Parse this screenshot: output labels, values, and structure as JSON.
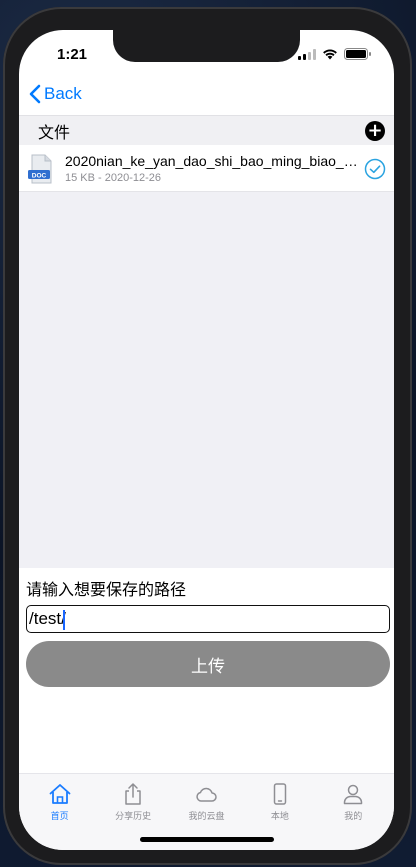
{
  "status_bar": {
    "time": "1:21"
  },
  "nav": {
    "back_label": "Back"
  },
  "section": {
    "title": "文件"
  },
  "file": {
    "icon_label": "DOC",
    "name": "2020nian_ke_yan_dao_shi_bao_ming_biao_.d...",
    "meta": "15 KB - 2020-12-26"
  },
  "path": {
    "label": "请输入想要保存的路径",
    "value": "/test/"
  },
  "upload": {
    "label": "上传"
  },
  "tabs": [
    {
      "label": "首页",
      "icon": "home-icon",
      "active": true
    },
    {
      "label": "分享历史",
      "icon": "share-icon",
      "active": false
    },
    {
      "label": "我的云盘",
      "icon": "cloud-icon",
      "active": false
    },
    {
      "label": "本地",
      "icon": "phone-icon",
      "active": false
    },
    {
      "label": "我的",
      "icon": "person-icon",
      "active": false
    }
  ],
  "colors": {
    "accent": "#007aff",
    "tab_active": "#1a7cff",
    "button_disabled": "#8a8a8a",
    "check": "#2aa3e0"
  }
}
